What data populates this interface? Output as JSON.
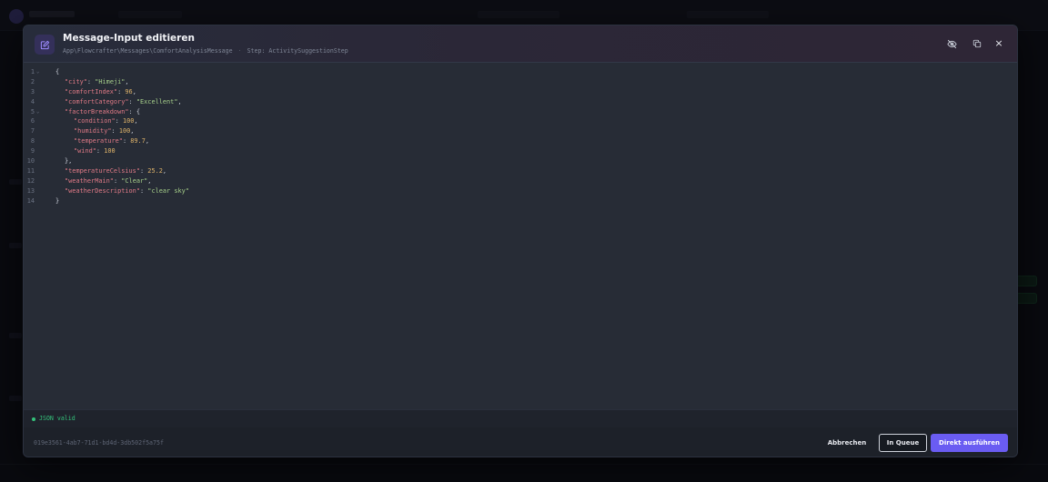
{
  "modal": {
    "title": "Message-Input editieren",
    "class_path": "App\\Flowcrafter\\Messages\\ComfortAnalysisMessage",
    "separator": "·",
    "step": "Step: ActivitySuggestionStep",
    "header_icon": "edit-icon",
    "actions": {
      "hide_icon": "eye-off-icon",
      "copy_icon": "copy-icon",
      "close_icon": "close-icon",
      "close_label": "×"
    }
  },
  "editor": {
    "lines": [
      {
        "n": "1",
        "fold": "⌄",
        "parts": [
          {
            "t": "pun",
            "v": "{"
          }
        ],
        "indent": 0
      },
      {
        "n": "2",
        "fold": "",
        "parts": [
          {
            "t": "key",
            "v": "\"city\""
          },
          {
            "t": "pun",
            "v": ": "
          },
          {
            "t": "str",
            "v": "\"Himeji\""
          },
          {
            "t": "pun",
            "v": ","
          }
        ],
        "indent": 1
      },
      {
        "n": "3",
        "fold": "",
        "parts": [
          {
            "t": "key",
            "v": "\"comfortIndex\""
          },
          {
            "t": "pun",
            "v": ": "
          },
          {
            "t": "num",
            "v": "96"
          },
          {
            "t": "pun",
            "v": ","
          }
        ],
        "indent": 1
      },
      {
        "n": "4",
        "fold": "",
        "parts": [
          {
            "t": "key",
            "v": "\"comfortCategory\""
          },
          {
            "t": "pun",
            "v": ": "
          },
          {
            "t": "str",
            "v": "\"Excellent\""
          },
          {
            "t": "pun",
            "v": ","
          }
        ],
        "indent": 1
      },
      {
        "n": "5",
        "fold": "⌄",
        "parts": [
          {
            "t": "key",
            "v": "\"factorBreakdown\""
          },
          {
            "t": "pun",
            "v": ": {"
          }
        ],
        "indent": 1
      },
      {
        "n": "6",
        "fold": "",
        "parts": [
          {
            "t": "key",
            "v": "\"condition\""
          },
          {
            "t": "pun",
            "v": ": "
          },
          {
            "t": "num",
            "v": "100"
          },
          {
            "t": "pun",
            "v": ","
          }
        ],
        "indent": 2
      },
      {
        "n": "7",
        "fold": "",
        "parts": [
          {
            "t": "key",
            "v": "\"humidity\""
          },
          {
            "t": "pun",
            "v": ": "
          },
          {
            "t": "num",
            "v": "100"
          },
          {
            "t": "pun",
            "v": ","
          }
        ],
        "indent": 2
      },
      {
        "n": "8",
        "fold": "",
        "parts": [
          {
            "t": "key",
            "v": "\"temperature\""
          },
          {
            "t": "pun",
            "v": ": "
          },
          {
            "t": "num",
            "v": "89.7"
          },
          {
            "t": "pun",
            "v": ","
          }
        ],
        "indent": 2
      },
      {
        "n": "9",
        "fold": "",
        "parts": [
          {
            "t": "key",
            "v": "\"wind\""
          },
          {
            "t": "pun",
            "v": ": "
          },
          {
            "t": "num",
            "v": "100"
          }
        ],
        "indent": 2
      },
      {
        "n": "10",
        "fold": "",
        "parts": [
          {
            "t": "pun",
            "v": "},"
          }
        ],
        "indent": 1
      },
      {
        "n": "11",
        "fold": "",
        "parts": [
          {
            "t": "key",
            "v": "\"temperatureCelsius\""
          },
          {
            "t": "pun",
            "v": ": "
          },
          {
            "t": "num",
            "v": "25.2"
          },
          {
            "t": "pun",
            "v": ","
          }
        ],
        "indent": 1
      },
      {
        "n": "12",
        "fold": "",
        "parts": [
          {
            "t": "key",
            "v": "\"weatherMain\""
          },
          {
            "t": "pun",
            "v": ": "
          },
          {
            "t": "str",
            "v": "\"Clear\""
          },
          {
            "t": "pun",
            "v": ","
          }
        ],
        "indent": 1
      },
      {
        "n": "13",
        "fold": "",
        "parts": [
          {
            "t": "key",
            "v": "\"weatherDescription\""
          },
          {
            "t": "pun",
            "v": ": "
          },
          {
            "t": "str",
            "v": "\"clear sky\""
          }
        ],
        "indent": 1
      },
      {
        "n": "14",
        "fold": "",
        "parts": [
          {
            "t": "pun",
            "v": "}"
          }
        ],
        "indent": 0
      }
    ]
  },
  "status": {
    "text": "JSON valid",
    "color": "#34c17a"
  },
  "footer": {
    "message_id": "019e3561-4ab7-71d1-bd4d-3db502f5a75f",
    "cancel_label": "Abbrechen",
    "queue_label": "In Queue",
    "run_label": "Direkt ausführen",
    "accent_color": "#6a5cf2"
  }
}
